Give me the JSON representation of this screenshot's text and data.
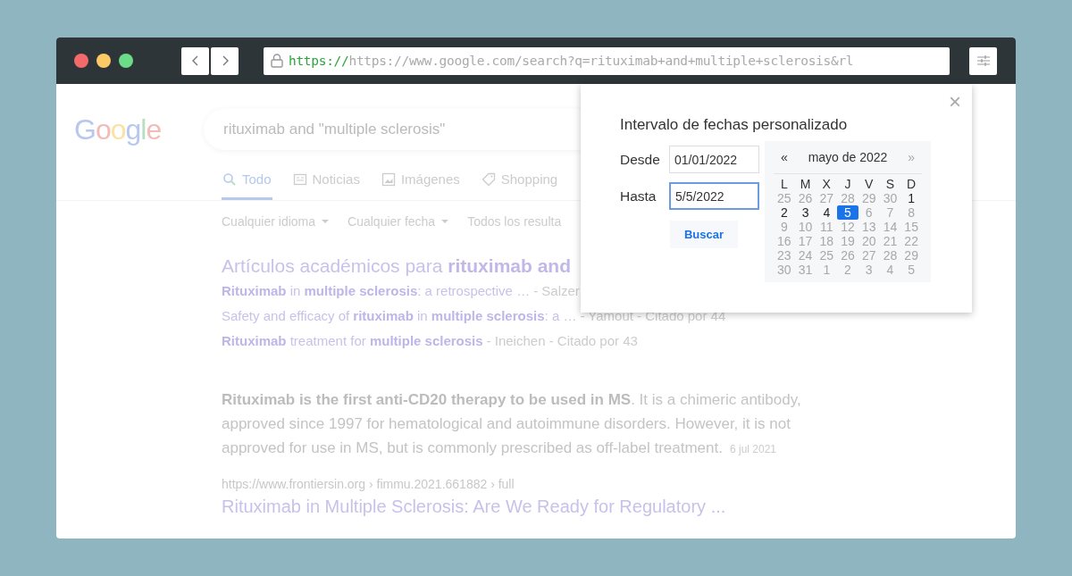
{
  "browser": {
    "url_scheme": "https://",
    "url": "https://www.google.com/search?q=rituximab+and+multiple+sclerosis&rl"
  },
  "logo": "Google",
  "search": {
    "query": "rituximab and \"multiple sclerosis\""
  },
  "tabs": [
    {
      "label": "Todo",
      "selected": true
    },
    {
      "label": "Noticias",
      "selected": false
    },
    {
      "label": "Imágenes",
      "selected": false
    },
    {
      "label": "Shopping",
      "selected": false
    }
  ],
  "filters": [
    {
      "label": "Cualquier idioma",
      "dropdown": true
    },
    {
      "label": "Cualquier fecha",
      "dropdown": true
    },
    {
      "label": "Todos los resulta",
      "dropdown": false
    }
  ],
  "scholar": {
    "heading": "Artículos académicos para **rituximab and**",
    "items": [
      {
        "title": "**Rituximab** in **multiple sclerosis**: a retrospective …",
        "meta": "- Salzer"
      },
      {
        "title": "Safety and efficacy of **rituximab** in **multiple sclerosis**: a …",
        "meta": "- Yamout - Citado por 44"
      },
      {
        "title": "**Rituximab** treatment for **multiple sclerosis**",
        "meta": "- Ineichen - Citado por 43"
      }
    ]
  },
  "snippet": {
    "text": "**Rituximab is the first anti-CD20 therapy to be used in MS**. It is a chimeric antibody, approved since 1997 for hematological and autoimmune disorders. However, it is not approved for use in MS, but is commonly prescribed as off-label treatment.",
    "date": "6 jul 2021"
  },
  "result": {
    "url": "https://www.frontiersin.org › fimmu.2021.661882 › full",
    "title": "Rituximab in Multiple Sclerosis: Are We Ready for Regulatory ..."
  },
  "dialog": {
    "close": "×",
    "title": "Intervalo de fechas personalizado",
    "fields": [
      {
        "label": "Desde",
        "value": "01/01/2022",
        "focused": false
      },
      {
        "label": "Hasta",
        "value": "5/5/2022",
        "focused": true
      }
    ],
    "button": "Buscar",
    "calendar": {
      "prev": "«",
      "month": "mayo de 2022",
      "next": "»",
      "next_disabled": true,
      "weekdays": [
        "L",
        "M",
        "X",
        "J",
        "V",
        "S",
        "D"
      ],
      "weeks": [
        [
          {
            "day": "25",
            "muted": true,
            "selected": false
          },
          {
            "day": "26",
            "muted": true,
            "selected": false
          },
          {
            "day": "27",
            "muted": true,
            "selected": false
          },
          {
            "day": "28",
            "muted": true,
            "selected": false
          },
          {
            "day": "29",
            "muted": true,
            "selected": false
          },
          {
            "day": "30",
            "muted": true,
            "selected": false
          },
          {
            "day": "1",
            "muted": false,
            "selected": false
          }
        ],
        [
          {
            "day": "2",
            "muted": false,
            "selected": false
          },
          {
            "day": "3",
            "muted": false,
            "selected": false
          },
          {
            "day": "4",
            "muted": false,
            "selected": false
          },
          {
            "day": "5",
            "muted": false,
            "selected": true
          },
          {
            "day": "6",
            "muted": true,
            "selected": false
          },
          {
            "day": "7",
            "muted": true,
            "selected": false
          },
          {
            "day": "8",
            "muted": true,
            "selected": false
          }
        ],
        [
          {
            "day": "9",
            "muted": true,
            "selected": false
          },
          {
            "day": "10",
            "muted": true,
            "selected": false
          },
          {
            "day": "11",
            "muted": true,
            "selected": false
          },
          {
            "day": "12",
            "muted": true,
            "selected": false
          },
          {
            "day": "13",
            "muted": true,
            "selected": false
          },
          {
            "day": "14",
            "muted": true,
            "selected": false
          },
          {
            "day": "15",
            "muted": true,
            "selected": false
          }
        ],
        [
          {
            "day": "16",
            "muted": true,
            "selected": false
          },
          {
            "day": "17",
            "muted": true,
            "selected": false
          },
          {
            "day": "18",
            "muted": true,
            "selected": false
          },
          {
            "day": "19",
            "muted": true,
            "selected": false
          },
          {
            "day": "20",
            "muted": true,
            "selected": false
          },
          {
            "day": "21",
            "muted": true,
            "selected": false
          },
          {
            "day": "22",
            "muted": true,
            "selected": false
          }
        ],
        [
          {
            "day": "23",
            "muted": true,
            "selected": false
          },
          {
            "day": "24",
            "muted": true,
            "selected": false
          },
          {
            "day": "25",
            "muted": true,
            "selected": false
          },
          {
            "day": "26",
            "muted": true,
            "selected": false
          },
          {
            "day": "27",
            "muted": true,
            "selected": false
          },
          {
            "day": "28",
            "muted": true,
            "selected": false
          },
          {
            "day": "29",
            "muted": true,
            "selected": false
          }
        ],
        [
          {
            "day": "30",
            "muted": true,
            "selected": false
          },
          {
            "day": "31",
            "muted": true,
            "selected": false
          },
          {
            "day": "1",
            "muted": true,
            "selected": false
          },
          {
            "day": "2",
            "muted": true,
            "selected": false
          },
          {
            "day": "3",
            "muted": true,
            "selected": false
          },
          {
            "day": "4",
            "muted": true,
            "selected": false
          },
          {
            "day": "5",
            "muted": true,
            "selected": false
          }
        ]
      ]
    }
  }
}
